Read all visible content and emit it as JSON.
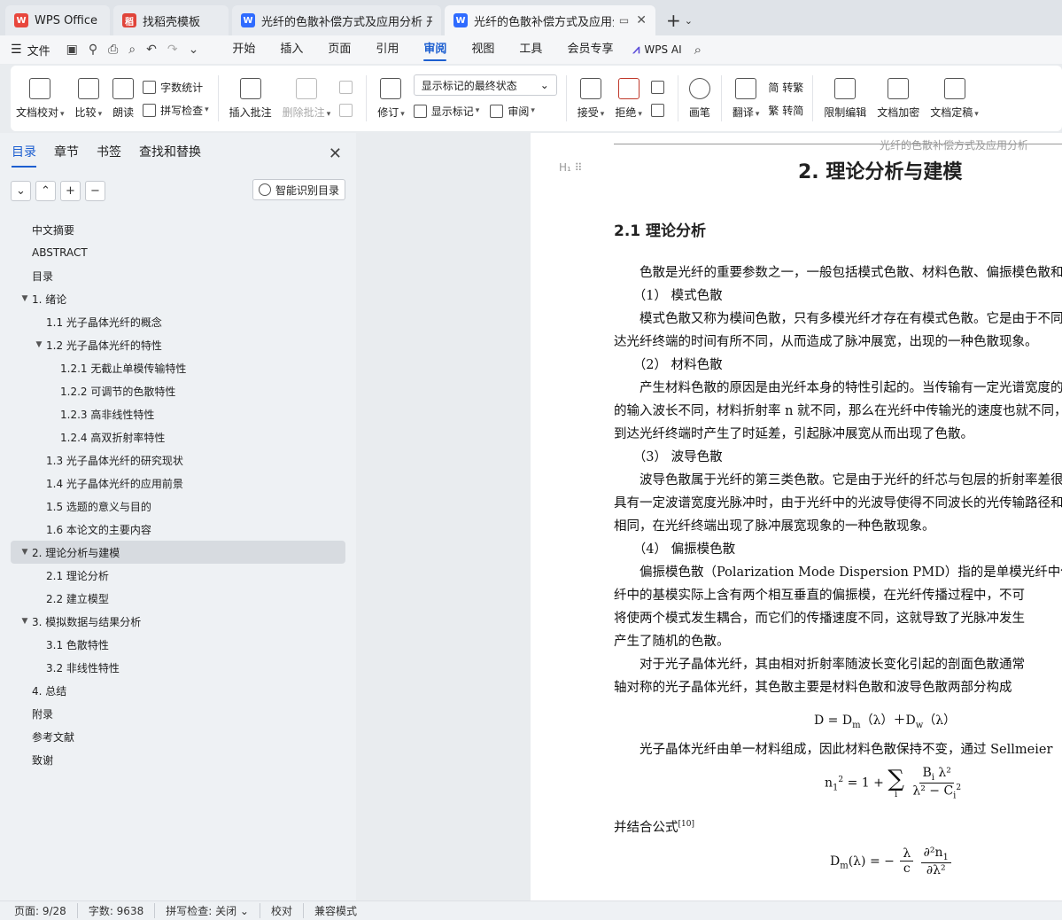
{
  "tabs": [
    {
      "label": "WPS Office",
      "icon": "wps-logo-icon",
      "color": "#e8473d",
      "letter": "W"
    },
    {
      "label": "找稻壳模板",
      "icon": "docer-logo-icon",
      "color": "#e0443a",
      "letter": "稻"
    },
    {
      "label": "光纤的色散补偿方式及应用分析 开题报告",
      "icon": "writer-doc-icon",
      "color": "#2f6bff",
      "letter": "W"
    },
    {
      "label": "光纤的色散补偿方式及应用分析",
      "icon": "writer-doc-icon",
      "color": "#2f6bff",
      "letter": "W",
      "active": true
    }
  ],
  "menubar": {
    "file": "文件",
    "tabs": [
      "开始",
      "插入",
      "页面",
      "引用",
      "审阅",
      "视图",
      "工具",
      "会员专享"
    ],
    "active_tab": "审阅",
    "wps_ai": "WPS AI"
  },
  "ribbon": {
    "doc_check": "文档校对",
    "compare": "比较",
    "read_aloud": "朗读",
    "word_count": "字数统计",
    "spell_check": "拼写检查",
    "insert_comment": "插入批注",
    "delete_comment": "删除批注",
    "track_changes": "修订",
    "markup_state": "显示标记的最终状态",
    "show_markup": "显示标记",
    "review_pane": "审阅",
    "accept": "接受",
    "reject": "拒绝",
    "pen": "画笔",
    "translate": "翻译",
    "to_traditional": "简 转繁",
    "to_simplified": "繁 转简",
    "restrict_edit": "限制编辑",
    "encrypt": "文档加密",
    "finalize": "文档定稿"
  },
  "nav": {
    "tabs": [
      "目录",
      "章节",
      "书签",
      "查找和替换"
    ],
    "smart_toc": "智能识别目录",
    "toc": [
      {
        "label": "中文摘要",
        "level": 1,
        "arrow": ""
      },
      {
        "label": "ABSTRACT",
        "level": 1,
        "arrow": ""
      },
      {
        "label": "目录",
        "level": 1,
        "arrow": ""
      },
      {
        "label": "1. 绪论",
        "level": 1,
        "arrow": "▼"
      },
      {
        "label": "1.1 光子晶体光纤的概念",
        "level": 2,
        "arrow": ""
      },
      {
        "label": "1.2 光子晶体光纤的特性",
        "level": 2,
        "arrow": "▼"
      },
      {
        "label": "1.2.1 无截止单模传输特性",
        "level": 3,
        "arrow": ""
      },
      {
        "label": "1.2.2 可调节的色散特性",
        "level": 3,
        "arrow": ""
      },
      {
        "label": "1.2.3 高非线性特性",
        "level": 3,
        "arrow": ""
      },
      {
        "label": "1.2.4 高双折射率特性",
        "level": 3,
        "arrow": ""
      },
      {
        "label": "1.3 光子晶体光纤的研究现状",
        "level": 2,
        "arrow": ""
      },
      {
        "label": "1.4 光子晶体光纤的应用前景",
        "level": 2,
        "arrow": ""
      },
      {
        "label": "1.5 选题的意义与目的",
        "level": 2,
        "arrow": ""
      },
      {
        "label": "1.6 本论文的主要内容",
        "level": 2,
        "arrow": ""
      },
      {
        "label": "2. 理论分析与建模",
        "level": 1,
        "arrow": "▼",
        "selected": true
      },
      {
        "label": "2.1 理论分析",
        "level": 2,
        "arrow": ""
      },
      {
        "label": "2.2 建立模型",
        "level": 2,
        "arrow": ""
      },
      {
        "label": "3. 模拟数据与结果分析",
        "level": 1,
        "arrow": "▼"
      },
      {
        "label": "3.1 色散特性",
        "level": 2,
        "arrow": ""
      },
      {
        "label": "3.2 非线性特性",
        "level": 2,
        "arrow": ""
      },
      {
        "label": "4. 总结",
        "level": 1,
        "arrow": ""
      },
      {
        "label": "附录",
        "level": 1,
        "arrow": ""
      },
      {
        "label": "参考文献",
        "level": 1,
        "arrow": ""
      },
      {
        "label": "致谢",
        "level": 1,
        "arrow": ""
      }
    ]
  },
  "doc": {
    "header": "光纤的色散补偿方式及应用分析",
    "heading_handle": "H₁ ⠿",
    "h1": "2.  理论分析与建模",
    "h2": "2.1  理论分析",
    "lines": [
      "　　色散是光纤的重要参数之一，一般包括模式色散、材料色散、偏振模色散和波导色散。",
      "　　（1）  模式色散",
      "　　模式色散又称为模间色散，只有多模光纤才存在有模式色散。它是由于不同模式的光",
      "达光纤终端的时间有所不同，从而造成了脉冲展宽，出现的一种色散现象。",
      "　　（2）  材料色散",
      "　　产生材料色散的原因是由光纤本身的特性引起的。当传输有一定光谱宽度的光脉冲时",
      "的输入波长不同，材料折射率 n 就不同，那么在光纤中传输光的速度也就不同，因此",
      "到达光纤终端时产生了时延差，引起脉冲展宽从而出现了色散。",
      "　　（3）  波导色散",
      "　　波导色散属于光纤的第三类色散。它是由于光纤的纤芯与包层的折射率差很小，当",
      "具有一定波谱宽度光脉冲时，由于光纤中的光波导使得不同波长的光传输路径和",
      "相同，在光纤终端出现了脉冲展宽现象的一种色散现象。",
      "　　（4）  偏振模色散",
      "　　偏振模色散（Polarization Mode Dispersion PMD）指的是单模光纤中偏振模",
      "纤中的基模实际上含有两个相互垂直的偏振模，在光纤传播过程中，不可",
      "将使两个模式发生耦合，而它们的传播速度不同，这就导致了光脉冲发生",
      "产生了随机的色散。",
      "　　对于光子晶体光纤，其由相对折射率随波长变化引起的剖面色散通常",
      "轴对称的光子晶体光纤，其色散主要是材料色散和波导色散两部分构成"
    ],
    "formula1": "D = D",
    "after_f1": "　　光子晶体光纤由单一材料组成，因此材料色散保持不变，通过 Sellmeier",
    "combine": "并结合公式",
    "cite": "[10]"
  },
  "status": {
    "page": "页面: 9/28",
    "words": "字数: 9638",
    "spell": "拼写检查: 关闭",
    "proof": "校对",
    "compat": "兼容模式"
  }
}
